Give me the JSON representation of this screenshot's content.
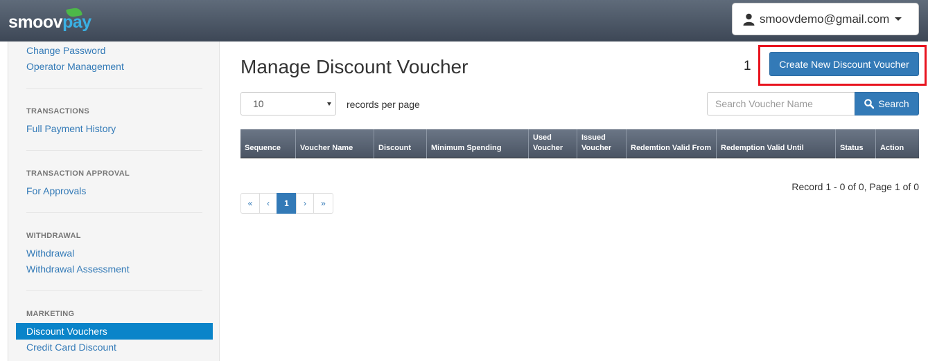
{
  "app": {
    "logo_main": "smoov",
    "logo_accent": "pay"
  },
  "user_menu": {
    "email": "smoovdemo@gmail.com",
    "icon": "user-icon"
  },
  "sidebar": {
    "top_links": [
      "Change Password",
      "Operator Management"
    ],
    "sections": [
      {
        "heading": "TRANSACTIONS",
        "items": [
          "Full Payment History"
        ]
      },
      {
        "heading": "TRANSACTION APPROVAL",
        "items": [
          "For Approvals"
        ]
      },
      {
        "heading": "WITHDRAWAL",
        "items": [
          "Withdrawal",
          "Withdrawal Assessment"
        ]
      },
      {
        "heading": "MARKETING",
        "items": [
          "Discount Vouchers",
          "Credit Card Discount"
        ],
        "active": "Discount Vouchers"
      }
    ]
  },
  "main": {
    "title": "Manage Discount Voucher",
    "step_marker": "1",
    "create_button": "Create New Discount Voucher",
    "page_size_value": "10",
    "records_per_page_label": "records per page",
    "search_placeholder": "Search Voucher Name",
    "search_button": "Search",
    "table_headers": [
      "Sequence",
      "Voucher Name",
      "Discount",
      "Minimum Spending",
      "Used Voucher",
      "Issued Voucher",
      "Redemtion Valid From",
      "Redemption Valid Until",
      "Status",
      "Action"
    ],
    "record_info": "Record 1 - 0 of 0, Page 1 of 0",
    "pagination": [
      "«",
      "‹",
      "1",
      "›",
      "»"
    ],
    "current_page": "1"
  },
  "colors": {
    "primary": "#337ab7",
    "sidebar_active": "#0a84c9",
    "highlight": "#e8141f",
    "topbar": "#4a5463"
  }
}
